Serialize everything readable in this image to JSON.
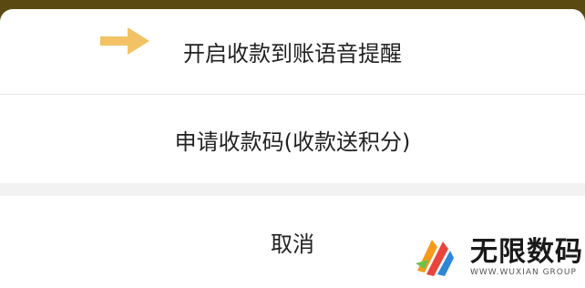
{
  "menu": {
    "voice_alert_label": "开启收款到账语音提醒",
    "apply_code_label": "申请收款码(收款送积分)",
    "cancel_label": "取消"
  },
  "watermark": {
    "brand_cn": "无限数码",
    "brand_en": "WWW.WUXIAN GROUP"
  },
  "colors": {
    "arrow": "#f2c265",
    "backdrop": "#5a4a12",
    "sheet": "#ffffff",
    "separator": "#f2f2f2"
  },
  "icons": {
    "pointer": "arrow-right-icon",
    "logo": "wuxian-logo"
  }
}
